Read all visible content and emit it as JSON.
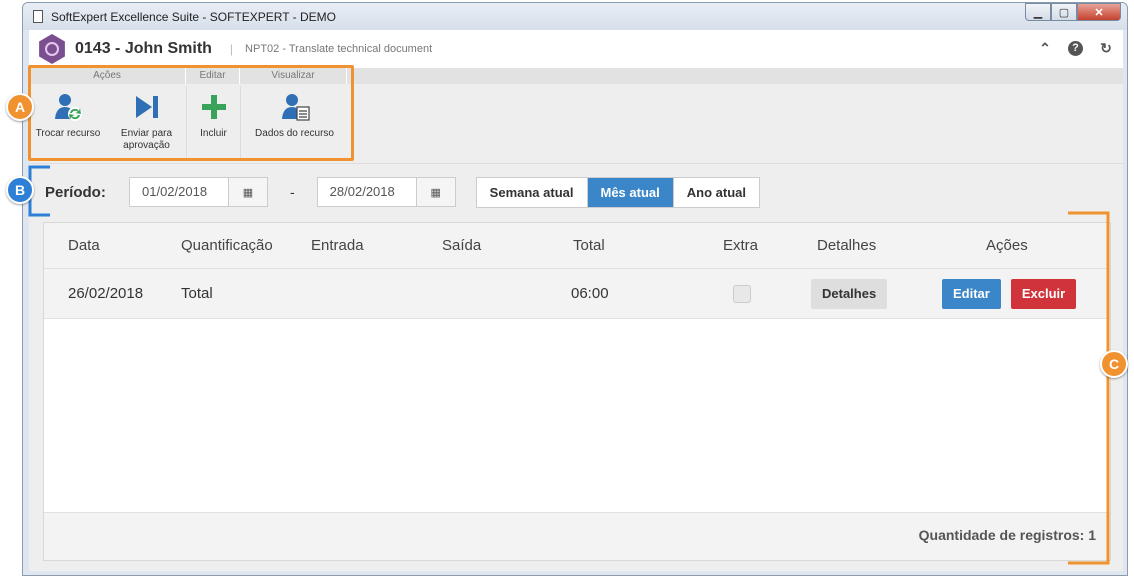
{
  "window": {
    "title": "SoftExpert Excellence Suite - SOFTEXPERT - DEMO"
  },
  "header": {
    "name": "0143 - John Smith",
    "separator": "|",
    "subtitle": "NPT02 - Translate technical document",
    "icons": [
      "collapse-icon",
      "help-icon",
      "refresh-icon"
    ]
  },
  "toolbar": {
    "groups": [
      "Ações",
      "Editar",
      "Visualizar"
    ],
    "buttons": {
      "trocar": "Trocar recurso",
      "enviar_line1": "Enviar para",
      "enviar_line2": "aprovação",
      "incluir": "Incluir",
      "dados": "Dados do recurso"
    }
  },
  "period": {
    "label": "Período:",
    "start": "01/02/2018",
    "end": "28/02/2018",
    "dash": "-",
    "segments": [
      "Semana atual",
      "Mês atual",
      "Ano atual"
    ],
    "active_segment": "Mês atual"
  },
  "table": {
    "headers": [
      "Data",
      "Quantificação",
      "Entrada",
      "Saída",
      "Total",
      "Extra",
      "Detalhes",
      "Ações"
    ],
    "rows": [
      {
        "data": "26/02/2018",
        "quantificacao": "Total",
        "entrada": "",
        "saida": "",
        "total": "06:00",
        "extra": false,
        "detalhes": "Detalhes",
        "editar": "Editar",
        "excluir": "Excluir"
      }
    ],
    "footer": "Quantidade de registros: 1"
  },
  "callouts": [
    "A",
    "B",
    "C"
  ],
  "colors": {
    "callout_orange": "#f0922f",
    "callout_blue": "#2e7fd6",
    "primary": "#3a86c8",
    "danger": "#d0343a"
  }
}
